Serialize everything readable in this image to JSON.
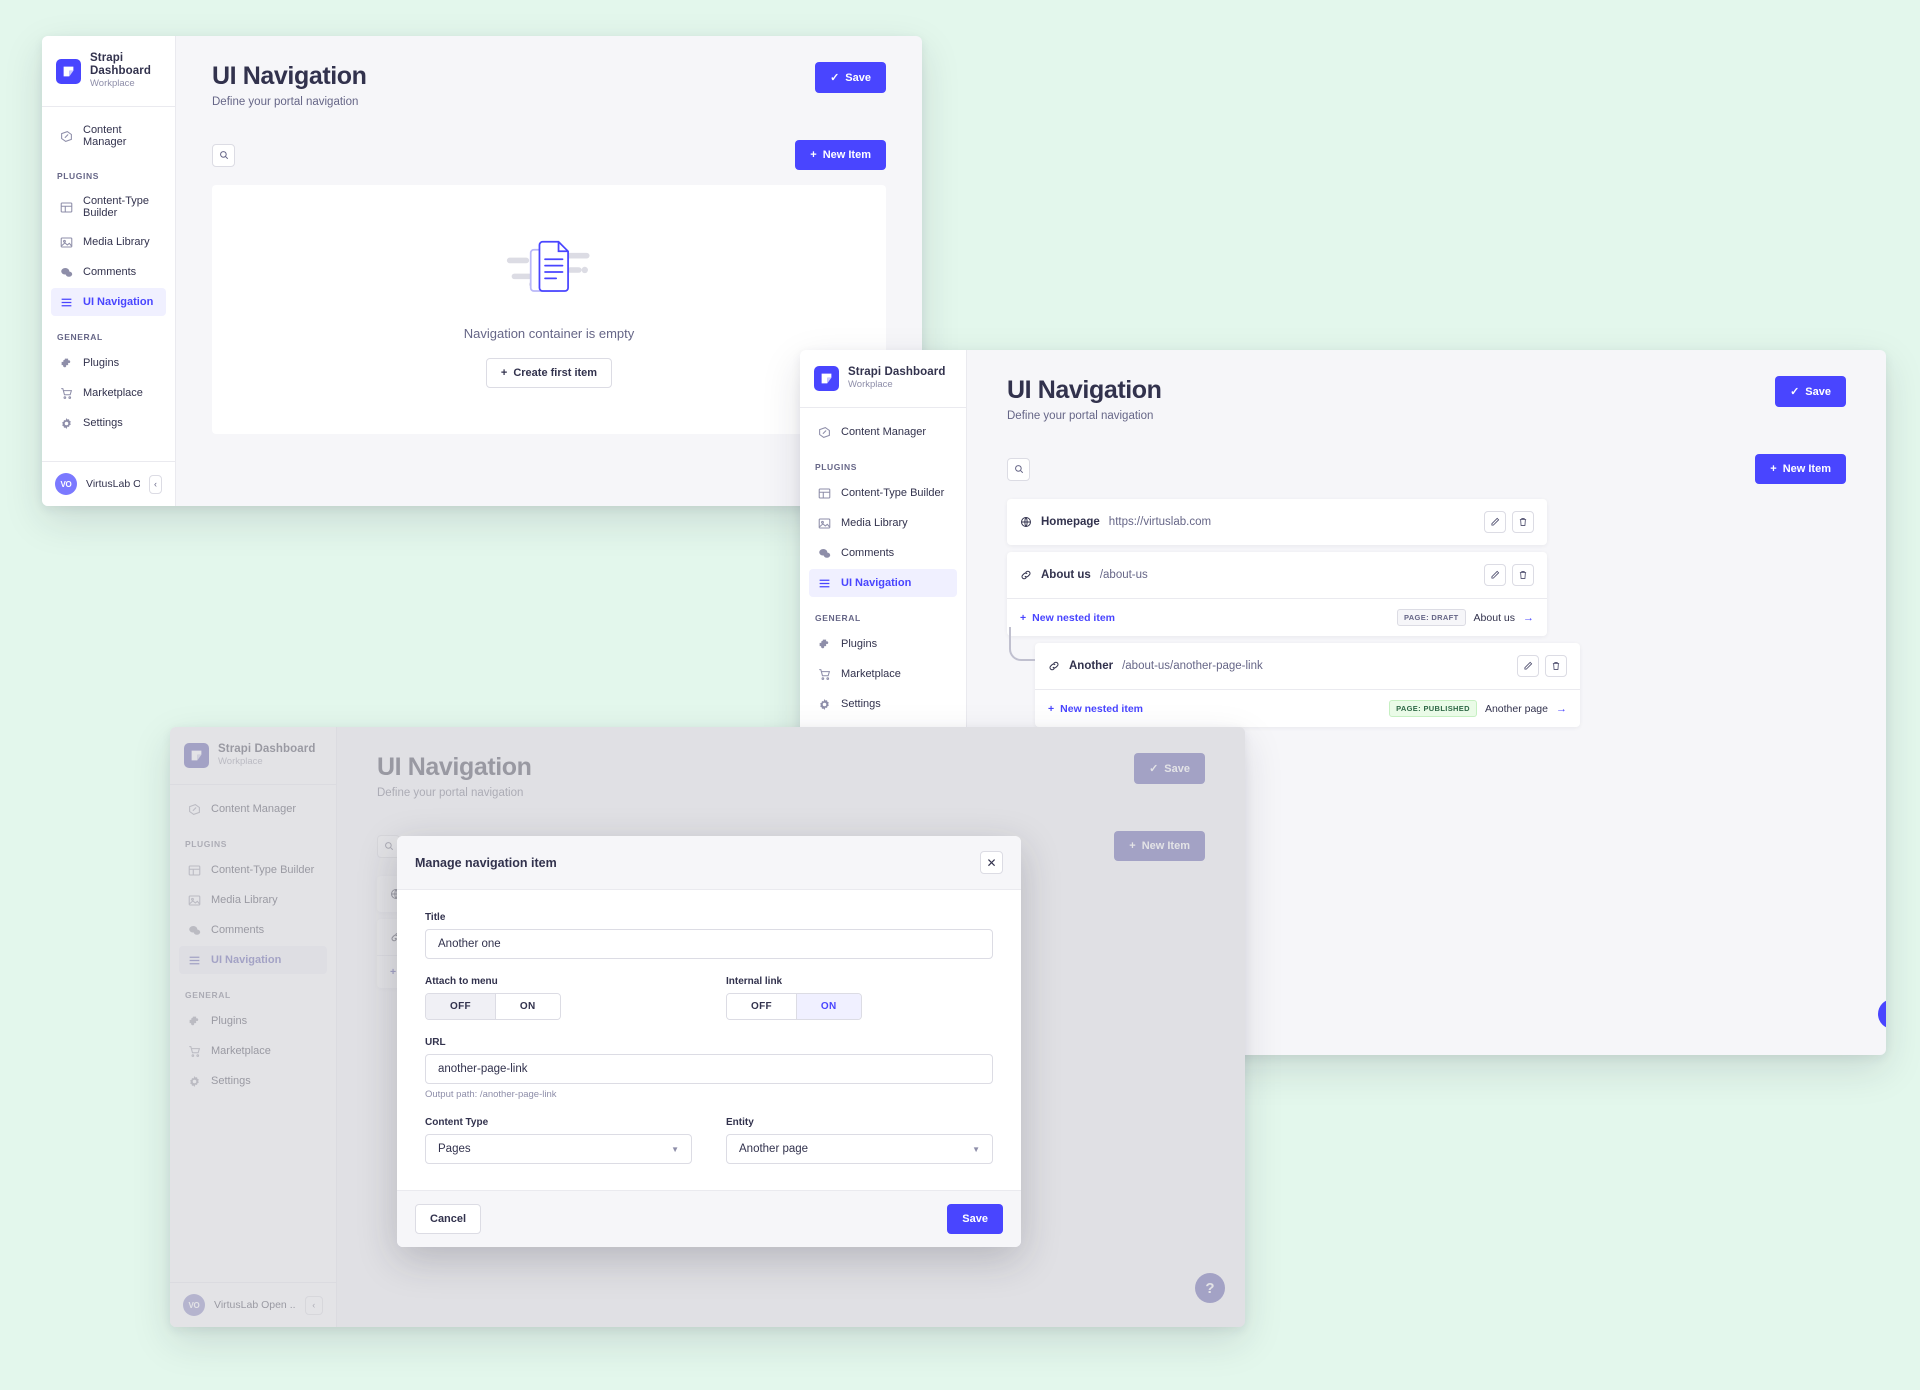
{
  "brand": {
    "title": "Strapi Dashboard",
    "subtitle": "Workplace",
    "logo_icon": "strapi-logo-icon",
    "accent": "#4945ff"
  },
  "sidebar": {
    "top_items": [
      {
        "label": "Content Manager",
        "icon": "pencil-square-icon"
      }
    ],
    "sections": [
      {
        "label": "PLUGINS",
        "items": [
          {
            "label": "Content-Type Builder",
            "icon": "layout-grid-icon",
            "active": false
          },
          {
            "label": "Media Library",
            "icon": "image-icon",
            "active": false
          },
          {
            "label": "Comments",
            "icon": "chat-bubbles-icon",
            "active": false
          },
          {
            "label": "UI Navigation",
            "icon": "hamburger-lines-icon",
            "active": true
          }
        ]
      },
      {
        "label": "GENERAL",
        "items": [
          {
            "label": "Plugins",
            "icon": "puzzle-piece-icon",
            "active": false
          },
          {
            "label": "Marketplace",
            "icon": "shopping-cart-icon",
            "active": false
          },
          {
            "label": "Settings",
            "icon": "gear-icon",
            "active": false
          }
        ]
      }
    ],
    "footer": {
      "avatar_initials": "VO",
      "name": "VirtusLab Open ...",
      "collapse_icon": "chevron-left-icon"
    }
  },
  "page": {
    "title": "UI Navigation",
    "subtitle": "Define your portal navigation",
    "save_label": "Save",
    "save_icon": "check-icon",
    "new_item_label": "New Item",
    "new_item_icon": "plus-icon",
    "search_icon": "search-icon"
  },
  "empty_state": {
    "illustration_icon": "documents-illustration-icon",
    "message": "Navigation container is empty",
    "cta_label": "Create first item",
    "cta_icon": "plus-icon"
  },
  "nav_items": [
    {
      "icon": "globe-icon",
      "name": "Homepage",
      "path": "https://virtuslab.com",
      "edit_icon": "pencil-icon",
      "delete_icon": "trash-icon",
      "has_footer": false
    },
    {
      "icon": "link-icon",
      "name": "About us",
      "path": "/about-us",
      "edit_icon": "pencil-icon",
      "delete_icon": "trash-icon",
      "has_footer": true,
      "footer": {
        "new_nested_label": "New nested item",
        "new_nested_icon": "plus-icon",
        "badge": "PAGE: DRAFT",
        "badge_state": "draft",
        "meta_title": "About us",
        "arrow_icon": "arrow-right-icon"
      }
    }
  ],
  "nested_item": {
    "icon": "link-icon",
    "name": "Another",
    "path": "/about-us/another-page-link",
    "edit_icon": "pencil-icon",
    "delete_icon": "trash-icon",
    "footer": {
      "new_nested_label": "New nested item",
      "new_nested_icon": "plus-icon",
      "badge": "PAGE: PUBLISHED",
      "badge_state": "published",
      "meta_title": "Another page",
      "arrow_icon": "arrow-right-icon"
    }
  },
  "help": {
    "label": "?",
    "icon": "question-mark-icon"
  },
  "modal": {
    "title": "Manage navigation item",
    "close_icon": "close-icon",
    "fields": {
      "title_label": "Title",
      "title_value": "Another one",
      "attach_label": "Attach to menu",
      "attach_off": "OFF",
      "attach_on": "ON",
      "attach_selected": "OFF",
      "internal_label": "Internal link",
      "internal_off": "OFF",
      "internal_on": "ON",
      "internal_selected": "ON",
      "url_label": "URL",
      "url_value": "another-page-link",
      "url_hint": "Output path: /another-page-link",
      "content_type_label": "Content Type",
      "content_type_value": "Pages",
      "entity_label": "Entity",
      "entity_value": "Another page",
      "caret_icon": "chevron-down-icon"
    },
    "cancel_label": "Cancel",
    "save_label": "Save"
  }
}
